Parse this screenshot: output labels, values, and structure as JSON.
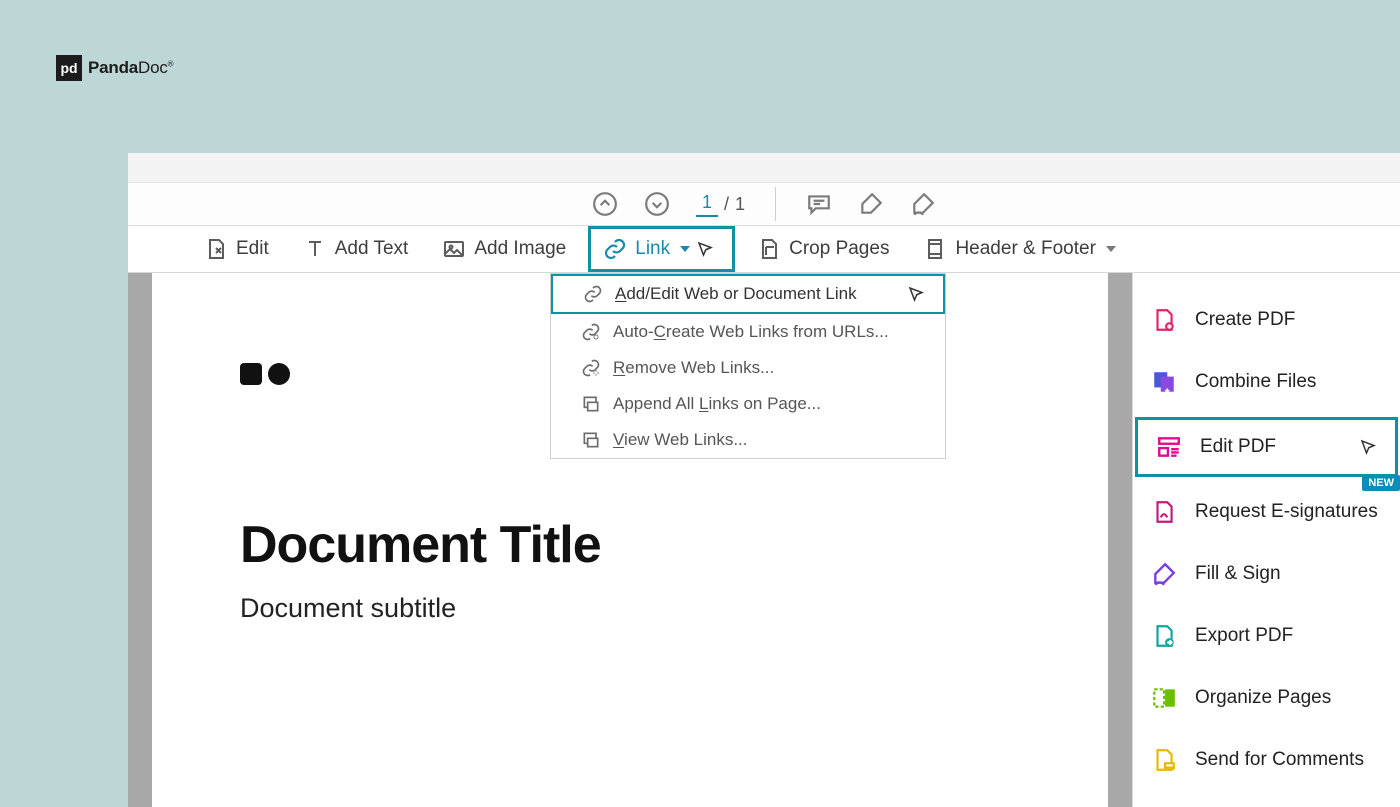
{
  "brand": {
    "logo_glyph": "pd",
    "name_bold": "Panda",
    "name_rest": "Doc"
  },
  "pagenav": {
    "current": "1",
    "sep": "/",
    "total": "1"
  },
  "toolbar": {
    "edit": "Edit",
    "add_text": "Add Text",
    "add_image": "Add Image",
    "link": "Link",
    "crop_pages": "Crop Pages",
    "header_footer": "Header & Footer"
  },
  "link_menu": {
    "add_edit": "Add/Edit Web or Document Link",
    "auto_create": "Auto-Create Web Links from URLs...",
    "remove": "Remove Web Links...",
    "append": "Append All Links on Page...",
    "view": "View Web Links..."
  },
  "document": {
    "title": "Document Title",
    "subtitle": "Document subtitle"
  },
  "right_panel": {
    "create_pdf": "Create PDF",
    "combine": "Combine Files",
    "edit_pdf": "Edit PDF",
    "request_esign": "Request E-signatures",
    "new_badge": "NEW",
    "fill_sign": "Fill & Sign",
    "export_pdf": "Export PDF",
    "organize": "Organize Pages",
    "send_comments": "Send for Comments"
  }
}
